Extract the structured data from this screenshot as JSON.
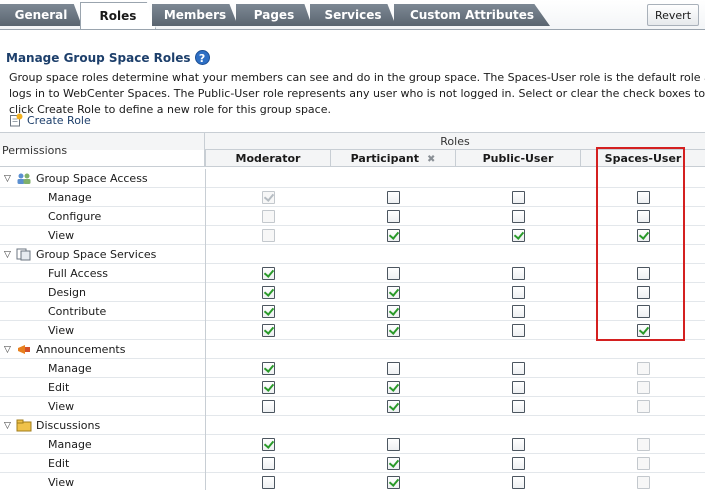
{
  "tabs": [
    {
      "label": "General",
      "active": false
    },
    {
      "label": "Roles",
      "active": true
    },
    {
      "label": "Members",
      "active": false
    },
    {
      "label": "Pages",
      "active": false
    },
    {
      "label": "Services",
      "active": false
    },
    {
      "label": "Custom Attributes",
      "active": false
    }
  ],
  "revert_label": "Revert",
  "section": {
    "title": "Manage Group Space Roles",
    "help_icon": "?",
    "description_lines": [
      "Group space roles determine what your members can see and do in the group space. The Spaces-User role is the default role assignment for any",
      "logs in to WebCenter Spaces. The Public-User role represents any user who is not logged in. Select or clear the check boxes to configure role per",
      "click Create Role to define a new role for this group space."
    ],
    "create_role_label": "Create Role"
  },
  "table": {
    "roles_label": "Roles",
    "permissions_label": "Permissions",
    "columns": [
      {
        "label": "Moderator",
        "removable": false
      },
      {
        "label": "Participant",
        "removable": true
      },
      {
        "label": "Public-User",
        "removable": false
      },
      {
        "label": "Spaces-User",
        "removable": false
      }
    ],
    "remove_glyph": "✖",
    "groups": [
      {
        "name": "Group Space Access",
        "icon": "group-access-icon",
        "rows": [
          {
            "name": "Manage",
            "checks": [
              true,
              false,
              false,
              false
            ],
            "disabled": [
              true,
              false,
              false,
              false
            ]
          },
          {
            "name": "Configure",
            "checks": [
              false,
              false,
              false,
              false
            ],
            "disabled": [
              true,
              false,
              false,
              false
            ]
          },
          {
            "name": "View",
            "checks": [
              false,
              true,
              true,
              true
            ],
            "disabled": [
              true,
              false,
              false,
              false
            ]
          }
        ]
      },
      {
        "name": "Group Space Services",
        "icon": "group-services-icon",
        "rows": [
          {
            "name": "Full Access",
            "checks": [
              true,
              false,
              false,
              false
            ],
            "disabled": [
              false,
              false,
              false,
              false
            ]
          },
          {
            "name": "Design",
            "checks": [
              true,
              true,
              false,
              false
            ],
            "disabled": [
              false,
              false,
              false,
              false
            ]
          },
          {
            "name": "Contribute",
            "checks": [
              true,
              true,
              false,
              false
            ],
            "disabled": [
              false,
              false,
              false,
              false
            ]
          },
          {
            "name": "View",
            "checks": [
              true,
              true,
              false,
              true
            ],
            "disabled": [
              false,
              false,
              false,
              false
            ]
          }
        ]
      },
      {
        "name": "Announcements",
        "icon": "announcements-icon",
        "rows": [
          {
            "name": "Manage",
            "checks": [
              true,
              false,
              false,
              false
            ],
            "disabled": [
              false,
              false,
              false,
              true
            ]
          },
          {
            "name": "Edit",
            "checks": [
              true,
              true,
              false,
              false
            ],
            "disabled": [
              false,
              false,
              false,
              true
            ]
          },
          {
            "name": "View",
            "checks": [
              false,
              true,
              false,
              false
            ],
            "disabled": [
              false,
              false,
              false,
              true
            ]
          }
        ]
      },
      {
        "name": "Discussions",
        "icon": "discussions-icon",
        "rows": [
          {
            "name": "Manage",
            "checks": [
              true,
              false,
              false,
              false
            ],
            "disabled": [
              false,
              false,
              false,
              true
            ]
          },
          {
            "name": "Edit",
            "checks": [
              false,
              true,
              false,
              false
            ],
            "disabled": [
              false,
              false,
              false,
              true
            ]
          },
          {
            "name": "View",
            "checks": [
              false,
              true,
              false,
              false
            ],
            "disabled": [
              false,
              false,
              false,
              true
            ]
          }
        ]
      }
    ]
  },
  "colors": {
    "tab_bg": "#5a6570",
    "check": "#2a9a2a",
    "highlight": "#d42020",
    "link": "#1d3f6b"
  }
}
